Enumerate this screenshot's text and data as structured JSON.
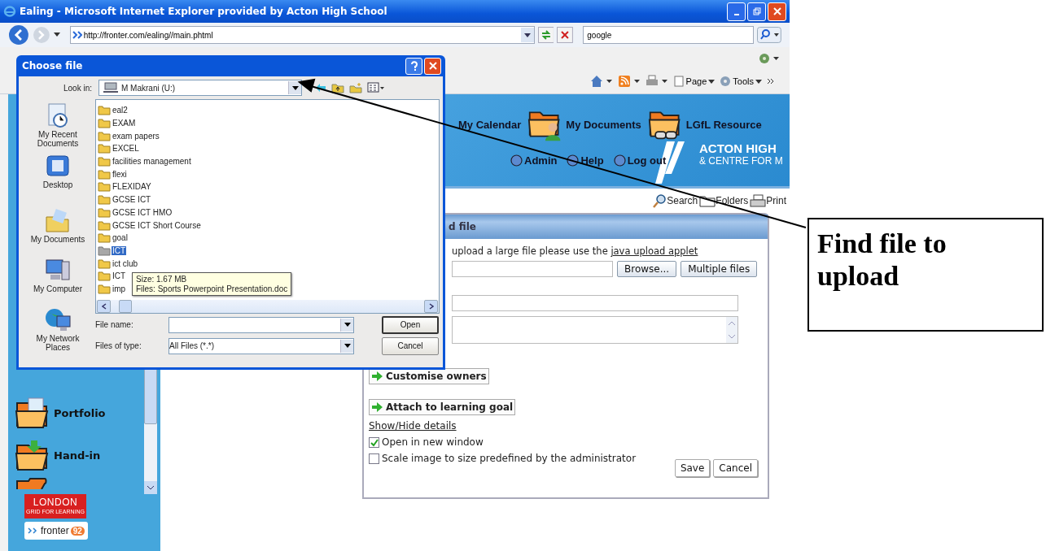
{
  "window": {
    "title": "Ealing - Microsoft Internet Explorer provided by Acton High School"
  },
  "address_bar": {
    "url": "http://fronter.com/ealing//main.phtml",
    "search": "google"
  },
  "command_bar": [
    "Page",
    "Tools"
  ],
  "sidebar": {
    "items": [
      {
        "label": "Portfolio",
        "kind": "portfolio"
      },
      {
        "label": "Hand-in",
        "kind": "handin"
      }
    ],
    "london": "LONDON",
    "london_sub": "GRID FOR LEARNING",
    "fronter": "fronter",
    "fronter_badge": "92"
  },
  "header": {
    "nav": [
      {
        "label": "My Calendar"
      },
      {
        "label": "My Documents"
      },
      {
        "label": "LGfL Resource"
      }
    ],
    "school": [
      "ACTON HIGH",
      "& CENTRE FOR M"
    ],
    "links": [
      "Admin",
      "Help",
      "Log out"
    ]
  },
  "tools": [
    "Search",
    "Folders",
    "Print"
  ],
  "upload_panel": {
    "title": "d file",
    "notice": "upload a large file please use the",
    "notice_link": "java upload applet",
    "browse": "Browse...",
    "multiple": "Multiple files",
    "customise": "Customise owners",
    "attach": "Attach to learning goal",
    "details_link": "Show/Hide details",
    "options": [
      {
        "label": "Open in new window",
        "checked": true
      },
      {
        "label": "Scale image to size predefined by the administrator",
        "checked": false
      }
    ],
    "buttons": [
      "Save",
      "Cancel"
    ]
  },
  "dialog": {
    "title": "Choose file",
    "look_in_label": "Look in:",
    "look_in": "M Makrani (U:)",
    "places": [
      {
        "label": "My Recent Documents",
        "kind": "recent"
      },
      {
        "label": "Desktop",
        "kind": "desktop"
      },
      {
        "label": "My Documents",
        "kind": "documents"
      },
      {
        "label": "My Computer",
        "kind": "computer"
      },
      {
        "label": "My Network Places",
        "kind": "network"
      }
    ],
    "files": [
      {
        "name": "eal2",
        "selected": false
      },
      {
        "name": "EXAM",
        "selected": false
      },
      {
        "name": "exam papers",
        "selected": false
      },
      {
        "name": "EXCEL",
        "selected": false
      },
      {
        "name": "facilities management",
        "selected": false
      },
      {
        "name": "flexi",
        "selected": false
      },
      {
        "name": "FLEXIDAY",
        "selected": false
      },
      {
        "name": "GCSE ICT",
        "selected": false
      },
      {
        "name": "GCSE ICT HMO",
        "selected": false
      },
      {
        "name": "GCSE ICT Short Course",
        "selected": false
      },
      {
        "name": "goal",
        "selected": false
      },
      {
        "name": "ICT",
        "selected": true
      },
      {
        "name": "ict club",
        "selected": false
      },
      {
        "name": "ICT",
        "selected": false
      },
      {
        "name": "imp",
        "selected": false
      }
    ],
    "tooltip": [
      "Size: 1.67 MB",
      "Files: Sports Powerpoint Presentation.doc"
    ],
    "file_name_label": "File name:",
    "file_type_label": "Files of type:",
    "file_type": "All Files (*.*)",
    "buttons": [
      "Open",
      "Cancel"
    ]
  },
  "callout": {
    "text": "Find file to upload"
  }
}
